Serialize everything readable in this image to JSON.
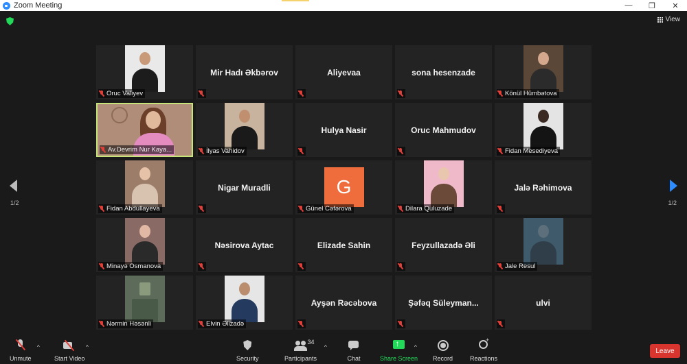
{
  "window": {
    "title": "Zoom Meeting",
    "controls": [
      "—",
      "❐",
      "✕"
    ]
  },
  "top": {
    "view_label": "View"
  },
  "pagination": {
    "left": "1/2",
    "right": "1/2"
  },
  "participants": [
    {
      "name": "Oruc Valiyev",
      "video": true
    },
    {
      "name": "Mir Hadı Əkbərov",
      "video": false
    },
    {
      "name": "Aliyevaa",
      "video": false
    },
    {
      "name": "sona hesenzade",
      "video": false
    },
    {
      "name": "Könül Hümbətova",
      "video": true
    },
    {
      "name": "Av.Devrim Nur Kaya...",
      "video": true,
      "active": true
    },
    {
      "name": "İlyas Vahidov",
      "video": true
    },
    {
      "name": "Hulya Nasir",
      "video": false
    },
    {
      "name": "Oruc Mahmudov",
      "video": false
    },
    {
      "name": "Fidan Mesediyeva",
      "video": true
    },
    {
      "name": "Fidan Abdullayeva",
      "video": true
    },
    {
      "name": "Nigar Muradli",
      "video": false
    },
    {
      "name": "Günel Cəfərova",
      "video": true,
      "avatar_letter": "G"
    },
    {
      "name": "Dilara Quluzade",
      "video": true
    },
    {
      "name": "Jalə Rəhimova",
      "video": false
    },
    {
      "name": "Minayə Osmanova",
      "video": true
    },
    {
      "name": "Nəsirova Aytac",
      "video": false
    },
    {
      "name": "Elizade Sahin",
      "video": false
    },
    {
      "name": "Feyzullazadə Əli",
      "video": false
    },
    {
      "name": "Jale Resul",
      "video": true
    },
    {
      "name": "Nərmin Həsənli",
      "video": true
    },
    {
      "name": "Elvin Əlizadə",
      "video": true
    },
    {
      "name": "Ayşən Rəcəbova",
      "video": false
    },
    {
      "name": "Şəfəq  Süleyman...",
      "video": false
    },
    {
      "name": "ulvi",
      "video": false
    }
  ],
  "toolbar": {
    "unmute": "Unmute",
    "start_video": "Start Video",
    "security": "Security",
    "participants": "Participants",
    "participants_count": "34",
    "chat": "Chat",
    "share_screen": "Share Screen",
    "record": "Record",
    "reactions": "Reactions",
    "leave": "Leave"
  },
  "colors": {
    "share_green": "#23d959",
    "leave_red": "#d9352f",
    "active_speaker_border": "#c7e47a",
    "muted_red": "#e0403a",
    "nav_blue": "#2d8cff"
  }
}
